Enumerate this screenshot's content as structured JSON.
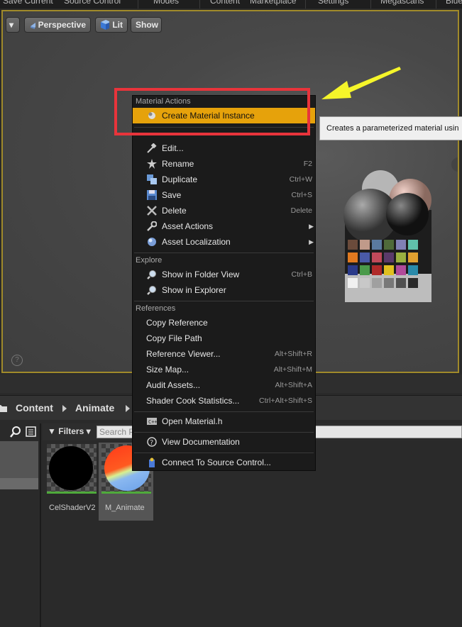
{
  "toolbar": {
    "items": [
      "Save Current",
      "Source Control",
      "Modes",
      "Content",
      "Marketplace",
      "Settings",
      "Megascans",
      "Blue"
    ]
  },
  "viewport": {
    "menu_button": "▾",
    "perspective_label": "Perspective",
    "lit_label": "Lit",
    "show_label": "Show",
    "help": "?"
  },
  "context_menu": {
    "sections": {
      "material_actions": "Material Actions",
      "explore": "Explore",
      "references": "References"
    },
    "create_material_instance": "Create Material Instance",
    "items": {
      "edit": {
        "label": "Edit...",
        "shortcut": ""
      },
      "rename": {
        "label": "Rename",
        "shortcut": "F2"
      },
      "duplicate": {
        "label": "Duplicate",
        "shortcut": "Ctrl+W"
      },
      "save": {
        "label": "Save",
        "shortcut": "Ctrl+S"
      },
      "delete": {
        "label": "Delete",
        "shortcut": "Delete"
      },
      "asset_actions": {
        "label": "Asset Actions",
        "shortcut": ""
      },
      "asset_localization": {
        "label": "Asset Localization",
        "shortcut": ""
      },
      "show_in_folder_view": {
        "label": "Show in Folder View",
        "shortcut": "Ctrl+B"
      },
      "show_in_explorer": {
        "label": "Show in Explorer",
        "shortcut": ""
      },
      "copy_reference": {
        "label": "Copy Reference",
        "shortcut": ""
      },
      "copy_file_path": {
        "label": "Copy File Path",
        "shortcut": ""
      },
      "reference_viewer": {
        "label": "Reference Viewer...",
        "shortcut": "Alt+Shift+R"
      },
      "size_map": {
        "label": "Size Map...",
        "shortcut": "Alt+Shift+M"
      },
      "audit_assets": {
        "label": "Audit Assets...",
        "shortcut": "Alt+Shift+A"
      },
      "shader_cook_statistics": {
        "label": "Shader Cook Statistics...",
        "shortcut": "Ctrl+Alt+Shift+S"
      },
      "open_material_h": {
        "label": "Open Material.h",
        "shortcut": ""
      },
      "view_documentation": {
        "label": "View Documentation",
        "shortcut": ""
      },
      "connect_to_source_control": {
        "label": "Connect To Source Control...",
        "shortcut": ""
      }
    }
  },
  "tooltip": {
    "text": "Creates a parameterized material usin"
  },
  "content_browser": {
    "breadcrumb": [
      "Content",
      "Animate"
    ],
    "filters_label": "Filters",
    "search_placeholder": "Search P",
    "assets": [
      {
        "name": "CelShaderV2"
      },
      {
        "name": "M_Animate"
      }
    ]
  },
  "colors": {
    "highlight": "#e6a20b",
    "annotation_box": "#e8343b",
    "annotation_arrow": "#f5f52a",
    "viewport_border": "#a08a2a"
  }
}
